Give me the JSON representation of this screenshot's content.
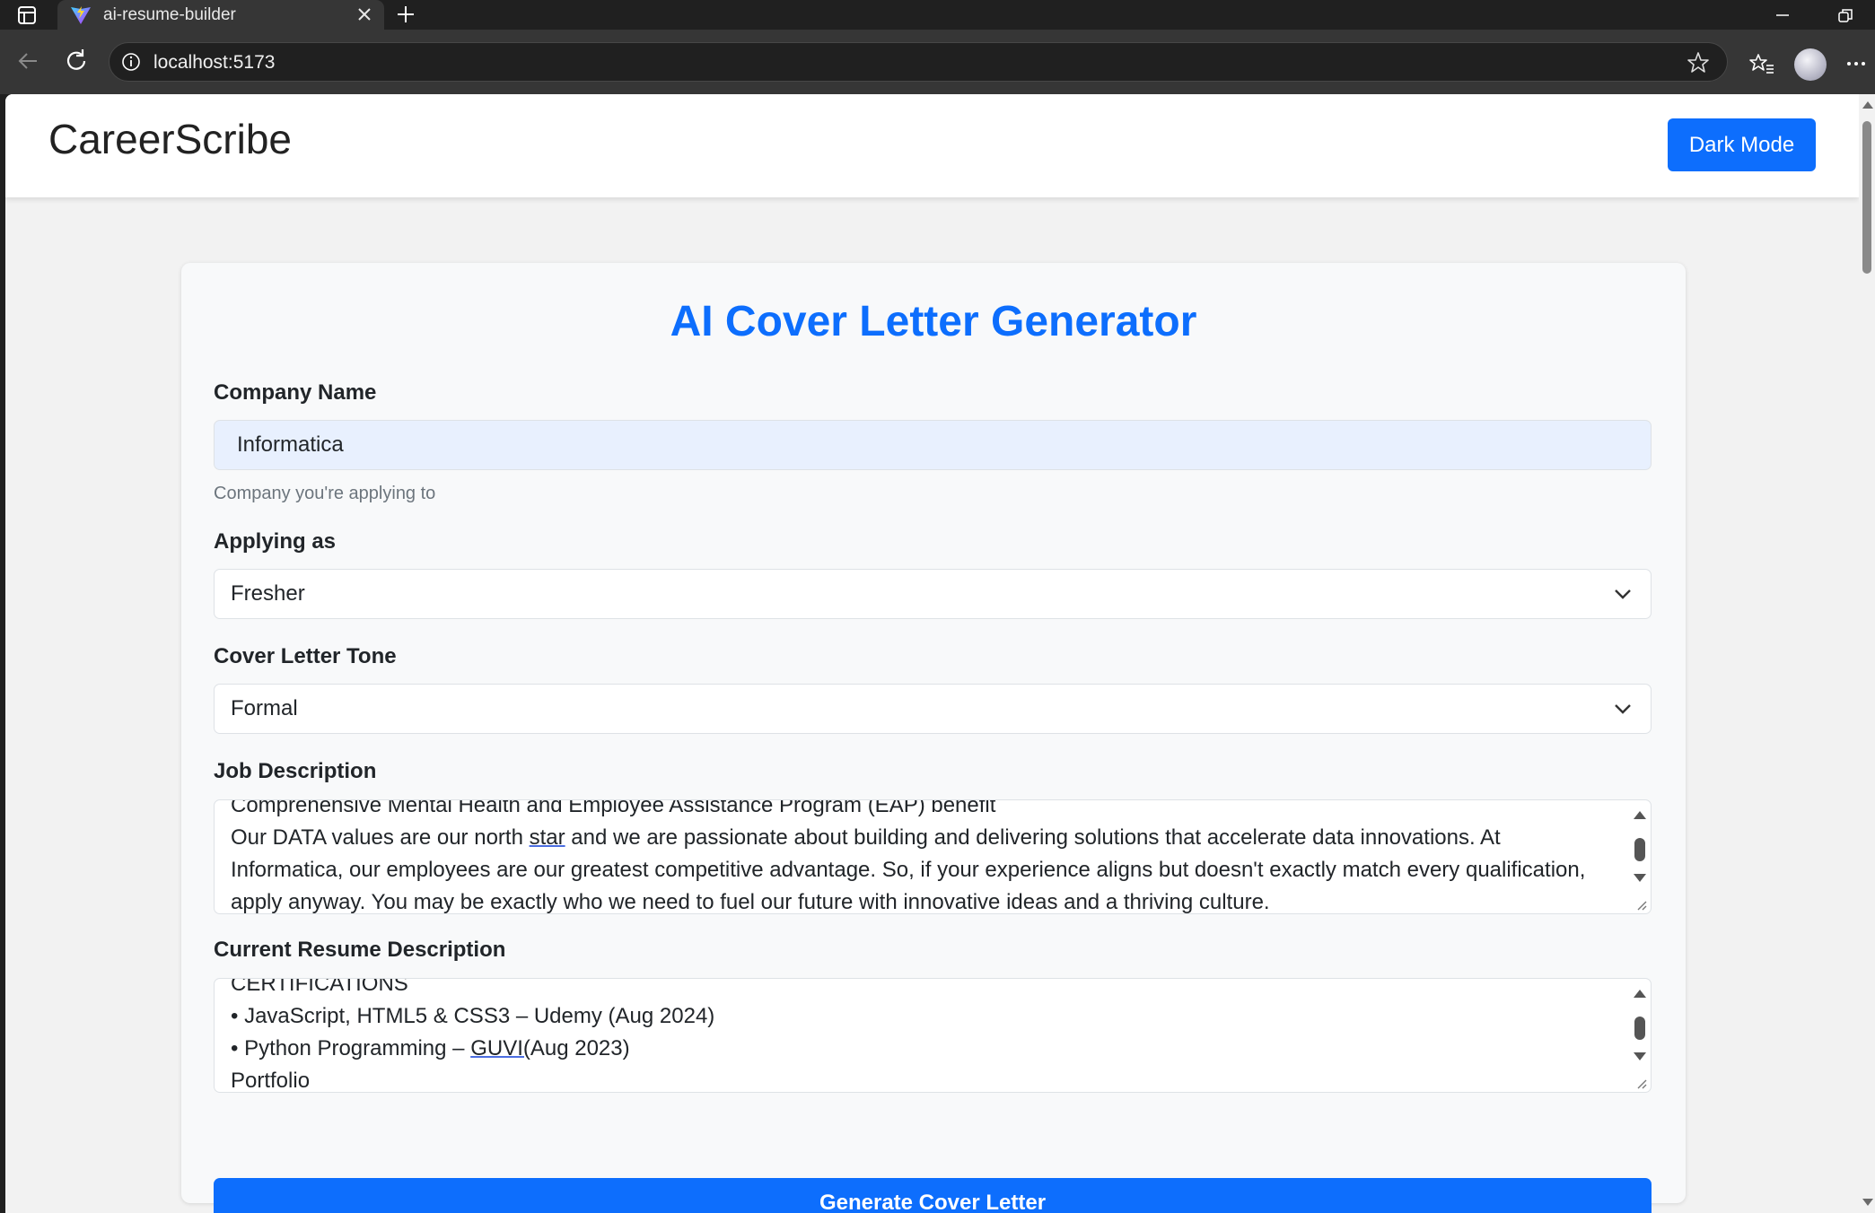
{
  "browser": {
    "tab_title": "ai-resume-builder",
    "url": "localhost:5173"
  },
  "navbar": {
    "brand": "CareerScribe",
    "dark_mode_label": "Dark Mode"
  },
  "form": {
    "title": "AI Cover Letter Generator",
    "company": {
      "label": "Company Name",
      "value": "Informatica",
      "help": "Company you're applying to"
    },
    "applying_as": {
      "label": "Applying as",
      "selected": "Fresher"
    },
    "tone": {
      "label": "Cover Letter Tone",
      "selected": "Formal"
    },
    "job_description": {
      "label": "Job Description",
      "lines": [
        "Comprehensive Mental Health and Employee Assistance Program (EAP) benefit",
        "Our DATA values are our north star and we are passionate about building and delivering solutions that accelerate data innovations. At",
        "Informatica, our employees are our greatest competitive advantage. So, if your experience aligns but doesn't exactly match every qualification,",
        "apply anyway. You may be exactly who we need to fuel our future with innovative ideas and a thriving culture."
      ]
    },
    "resume": {
      "label": "Current Resume Description",
      "lines": [
        "CERTIFICATIONS",
        "• JavaScript, HTML5 & CSS3 – Udemy (Aug 2024)",
        "• Python Programming – GUVI(Aug 2023)",
        "Portfolio"
      ]
    },
    "submit_label": "Generate Cover Letter"
  },
  "colors": {
    "primary": "#0d6efd",
    "input_autofill": "#e8f0fe",
    "card_bg": "#f8f9fa",
    "page_bg": "#f2f2f2"
  }
}
